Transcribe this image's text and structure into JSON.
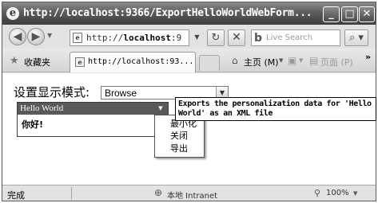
{
  "window": {
    "title": "http://localhost:9366/ExportHelloWorldWebForm...",
    "minimize_glyph": "_",
    "maximize_glyph": "□",
    "close_glyph": "✕"
  },
  "toolbar": {
    "back_glyph": "◀",
    "forward_glyph": "▶",
    "address_prefix": "http://",
    "address_host": "localhost",
    "address_rest": ":9",
    "refresh_glyph": "↻",
    "stop_glyph": "✕",
    "search_logo": "b",
    "search_placeholder": "Live Search",
    "search_glyph": "⌕"
  },
  "favorites_bar": {
    "favorites_label": "收藏夹",
    "tab_label": "http://localhost:93...",
    "home_label": "主页 (M)",
    "page_menu_label": "页面 (P)",
    "overflow_glyph": "»"
  },
  "page": {
    "mode_label": "设置显示模式:",
    "mode_select_value": "Browse",
    "webpart": {
      "title": "Hello World",
      "body_text": "你好!"
    },
    "verb_menu": {
      "items": [
        "最小化",
        "关闭",
        "导出"
      ]
    },
    "tooltip": "Exports the personalization data for 'Hello World' as an XML file"
  },
  "status_bar": {
    "status_text": "完成",
    "zone_label": "本地 Intranet",
    "zoom_label": "100%"
  }
}
